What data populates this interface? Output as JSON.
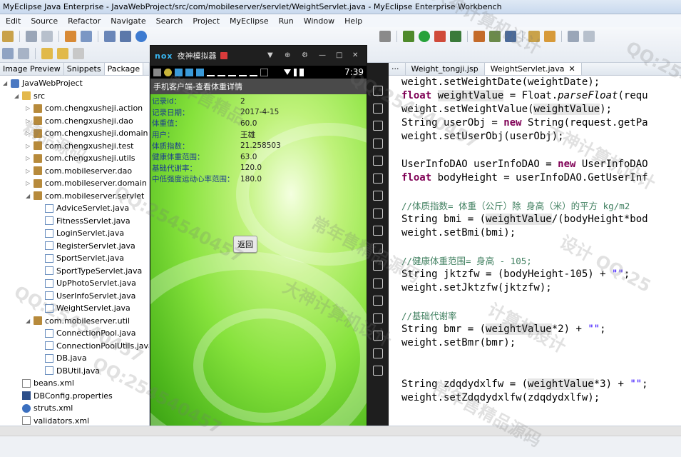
{
  "window": {
    "title": "MyEclipse Java Enterprise - JavaWebProject/src/com/mobileserver/servlet/WeightServlet.java - MyEclipse Enterprise Workbench"
  },
  "menu": [
    "Edit",
    "Source",
    "Refactor",
    "Navigate",
    "Search",
    "Project",
    "MyEclipse",
    "Run",
    "Window",
    "Help"
  ],
  "explorer": {
    "tabs": [
      "Image Preview",
      "Snippets",
      "Package"
    ],
    "items": [
      {
        "label": "JavaWebProject",
        "type": "project",
        "indent": 0
      },
      {
        "label": "src",
        "type": "folder",
        "indent": 1
      },
      {
        "label": "com.chengxusheji.action",
        "type": "pkg",
        "indent": 2
      },
      {
        "label": "com.chengxusheji.dao",
        "type": "pkg",
        "indent": 2
      },
      {
        "label": "com.chengxusheji.domain",
        "type": "pkg",
        "indent": 2
      },
      {
        "label": "com.chengxusheji.test",
        "type": "pkg",
        "indent": 2
      },
      {
        "label": "com.chengxusheji.utils",
        "type": "pkg",
        "indent": 2
      },
      {
        "label": "com.mobileserver.dao",
        "type": "pkg",
        "indent": 2
      },
      {
        "label": "com.mobileserver.domain",
        "type": "pkg",
        "indent": 2
      },
      {
        "label": "com.mobileserver.servlet",
        "type": "pkg",
        "indent": 2
      },
      {
        "label": "AdviceServlet.java",
        "type": "java",
        "indent": 3
      },
      {
        "label": "FitnessServlet.java",
        "type": "java",
        "indent": 3
      },
      {
        "label": "LoginServlet.java",
        "type": "java",
        "indent": 3
      },
      {
        "label": "RegisterServlet.java",
        "type": "java",
        "indent": 3
      },
      {
        "label": "SportServlet.java",
        "type": "java",
        "indent": 3
      },
      {
        "label": "SportTypeServlet.java",
        "type": "java",
        "indent": 3
      },
      {
        "label": "UpPhotoServlet.java",
        "type": "java",
        "indent": 3
      },
      {
        "label": "UserInfoServlet.java",
        "type": "java",
        "indent": 3
      },
      {
        "label": "WeightServlet.java",
        "type": "java",
        "indent": 3
      },
      {
        "label": "com.mobileserver.util",
        "type": "pkg",
        "indent": 2
      },
      {
        "label": "ConnectionPool.java",
        "type": "java",
        "indent": 3
      },
      {
        "label": "ConnectionPoolUtils.java",
        "type": "java",
        "indent": 3
      },
      {
        "label": "DB.java",
        "type": "java",
        "indent": 3
      },
      {
        "label": "DBUtil.java",
        "type": "java",
        "indent": 3
      },
      {
        "label": "beans.xml",
        "type": "xml",
        "indent": 1
      },
      {
        "label": "DBConfig.properties",
        "type": "props",
        "indent": 1
      },
      {
        "label": "struts.xml",
        "type": "struts",
        "indent": 1
      },
      {
        "label": "validators.xml",
        "type": "xml",
        "indent": 1
      }
    ]
  },
  "emulator": {
    "brand": "nox",
    "name": "夜神模拟器",
    "time": "7:39",
    "app_title": "手机客户端-查看体重详情",
    "fields": [
      {
        "label": "记录id：",
        "value": "2"
      },
      {
        "label": "记录日期：",
        "value": "2017-4-15"
      },
      {
        "label": "体重值：",
        "value": "60.0"
      },
      {
        "label": "用户：",
        "value": "王雄"
      },
      {
        "label": "体质指数：",
        "value": "21.258503"
      },
      {
        "label": "健康体重范围：",
        "value": "63.0"
      },
      {
        "label": "基础代谢率：",
        "value": "120.0"
      },
      {
        "label": "中低强度运动心率范围：",
        "value": "180.0"
      }
    ],
    "back_label": "返回"
  },
  "editor": {
    "tabs": [
      "Weight_tongji.jsp",
      "WeightServlet.java"
    ],
    "close_glyph": "✕"
  },
  "watermarks": [
    "大神计算机设计",
    "QQ:2545404",
    "常年售精品",
    "精品源码",
    "QQ:254540457",
    "大神计算机设计",
    "QQ:254540457",
    "常年售精品源码",
    "设计 QQ:25",
    "QQ:254540457",
    "大神计算机设计",
    "计算机设计",
    "QQ:254540457",
    "常年售精品源码"
  ]
}
